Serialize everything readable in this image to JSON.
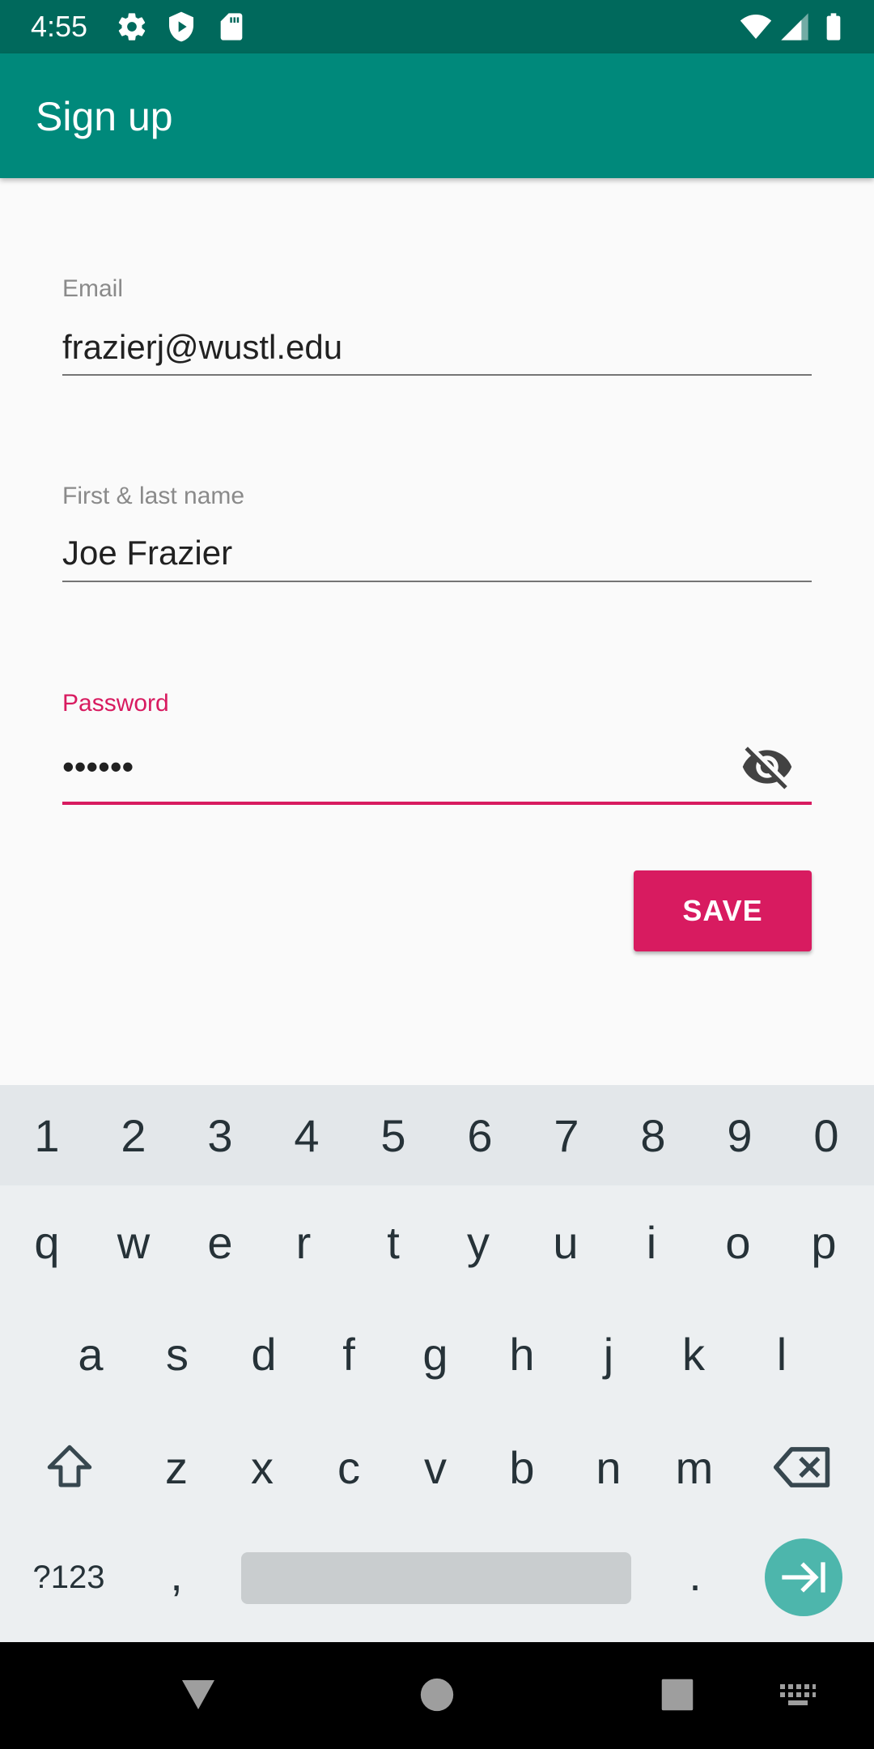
{
  "status_bar": {
    "time": "4:55",
    "left_icons": [
      "gear-icon",
      "shield-icon",
      "sd-card-icon"
    ],
    "right_icons": [
      "wifi-icon",
      "cell-signal-icon",
      "battery-icon"
    ]
  },
  "app_bar": {
    "title": "Sign up",
    "color": "#00897b"
  },
  "form": {
    "email": {
      "label": "Email",
      "value": "frazierj@wustl.edu"
    },
    "name": {
      "label": "First & last name",
      "value": "Joe Frazier"
    },
    "password": {
      "label": "Password",
      "value": "••••••",
      "toggle_icon": "visibility-off-icon"
    },
    "save_label": "SAVE",
    "accent_color": "#d81b60"
  },
  "keyboard": {
    "number_row": [
      "1",
      "2",
      "3",
      "4",
      "5",
      "6",
      "7",
      "8",
      "9",
      "0"
    ],
    "row1": [
      "q",
      "w",
      "e",
      "r",
      "t",
      "y",
      "u",
      "i",
      "o",
      "p"
    ],
    "row2": [
      "a",
      "s",
      "d",
      "f",
      "g",
      "h",
      "j",
      "k",
      "l"
    ],
    "row3": [
      "z",
      "x",
      "c",
      "v",
      "b",
      "n",
      "m"
    ],
    "symbols_label": "?123",
    "comma": ",",
    "period": ".",
    "shift_icon": "shift-icon",
    "backspace_icon": "backspace-icon",
    "enter_icon": "next-tab-icon"
  },
  "nav_bar": {
    "buttons": [
      "back-icon",
      "home-icon",
      "recents-icon",
      "keyboard-switch-icon"
    ]
  }
}
